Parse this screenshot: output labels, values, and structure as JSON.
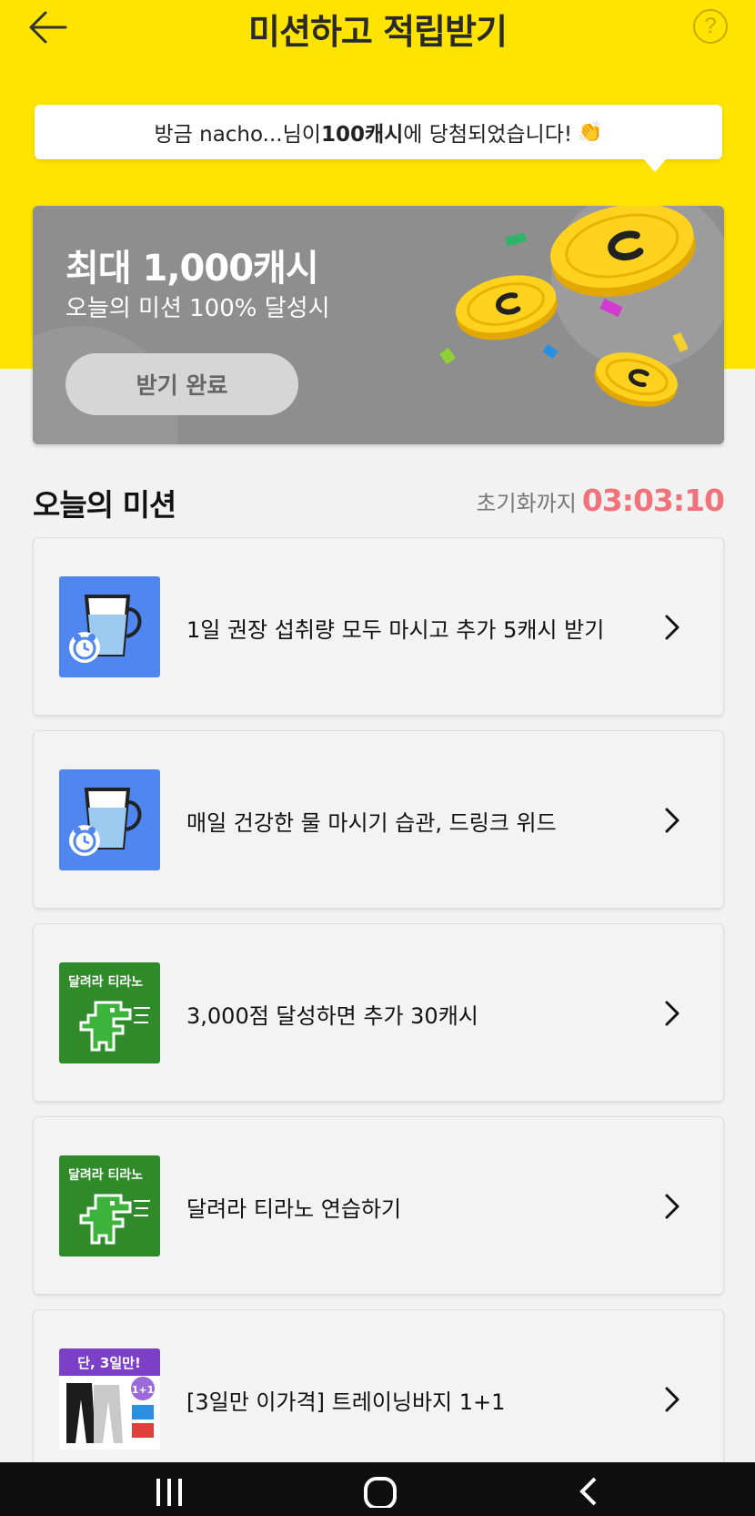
{
  "header": {
    "title": "미션하고 적립받기",
    "help_symbol": "?"
  },
  "toast": {
    "prefix": "방금 nacho...님이 ",
    "bold": "100캐시",
    "suffix": "에 당첨되었습니다!",
    "emoji": "👏"
  },
  "banner": {
    "title": "최대 1,000캐시",
    "subtitle": "오늘의 미션 100% 달성시",
    "button_label": "받기 완료"
  },
  "section": {
    "title": "오늘의 미션",
    "reset_label": "초기화까지",
    "reset_time": "03:03:10"
  },
  "missions": [
    {
      "label": "1일 권장 섭취량 모두 마시고 추가 5캐시 받기",
      "icon": "water-cup-icon"
    },
    {
      "label": "매일 건강한 물 마시기 습관, 드링크 위드",
      "icon": "water-cup-icon"
    },
    {
      "label": "3,000점 달성하면 추가 30캐시",
      "icon": "dino-game-icon",
      "thumb_text": "달려라 티라노"
    },
    {
      "label": "달려라 티라노 연습하기",
      "icon": "dino-game-icon",
      "thumb_text": "달려라 티라노"
    },
    {
      "label": "[3일만 이가격] 트레이닝바지 1+1",
      "icon": "training-pants-icon",
      "thumb_text": "단, 3일만!",
      "thumb_badge": "1+1"
    }
  ],
  "colors": {
    "brand_yellow": "#ffe400",
    "accent_red": "#f0727a",
    "banner_gray": "#8e8e8e"
  }
}
